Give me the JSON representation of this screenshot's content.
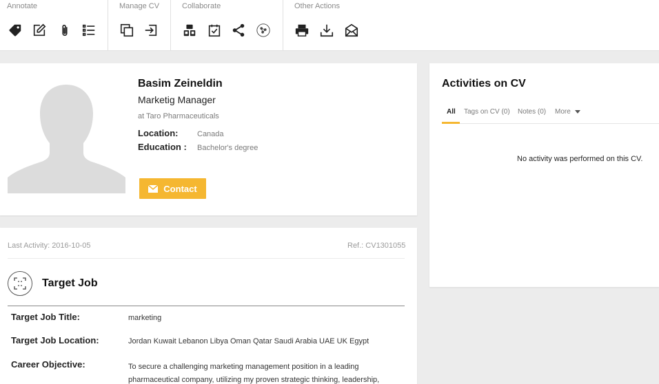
{
  "toolbar": {
    "groups": [
      {
        "title": "Annotate",
        "icons": [
          "tag-icon",
          "edit-icon",
          "attachment-icon",
          "list-icon"
        ]
      },
      {
        "title": "Manage CV",
        "icons": [
          "copy-icon",
          "move-icon"
        ]
      },
      {
        "title": "Collaborate",
        "icons": [
          "share-user-icon",
          "task-icon",
          "share-icon",
          "network-icon"
        ]
      },
      {
        "title": "Other Actions",
        "icons": [
          "print-icon",
          "download-icon",
          "email-icon"
        ]
      }
    ]
  },
  "profile": {
    "name": "Basim Zeineldin",
    "title": "Marketig Manager",
    "company": "at Taro Pharmaceuticals",
    "location_label": "Location:",
    "location_value": "Canada",
    "education_label": "Education :",
    "education_value": "Bachelor's degree",
    "contact_label": "Contact"
  },
  "activities": {
    "title": "Activities on CV",
    "tabs": [
      "All",
      "Tags on CV (0)",
      "Notes (0)",
      "More"
    ],
    "empty_message": "No activity was performed on this CV."
  },
  "details": {
    "last_activity": "Last Activity: 2016-10-05",
    "ref": "Ref.: CV1301055",
    "section_title": "Target Job",
    "fields": [
      {
        "label": "Target Job Title:",
        "value": "marketing"
      },
      {
        "label": "Target Job Location:",
        "value": "Jordan Kuwait Lebanon Libya Oman Qatar Saudi Arabia UAE UK Egypt"
      },
      {
        "label": "Career Objective:",
        "value": "To secure a challenging marketing management position in a leading pharmaceutical company, utilizing my proven strategic thinking, leadership,"
      }
    ]
  },
  "colors": {
    "accent": "#f5b731",
    "background": "#ececec"
  }
}
